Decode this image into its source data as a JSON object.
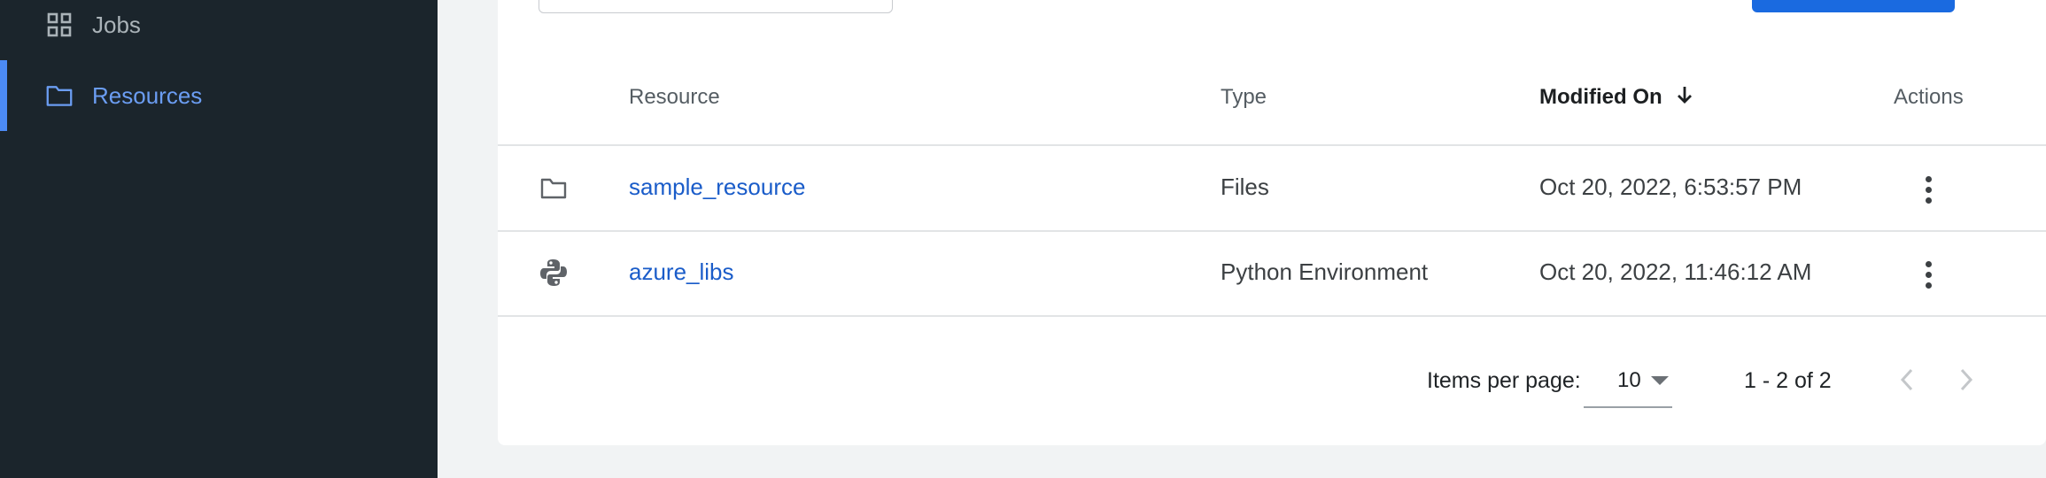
{
  "sidebar": {
    "items": [
      {
        "label": "Jobs",
        "icon": "grid-icon"
      },
      {
        "label": "Resources",
        "icon": "folder-icon",
        "active": true
      }
    ]
  },
  "table": {
    "columns": {
      "resource": "Resource",
      "type": "Type",
      "modified": "Modified On",
      "actions": "Actions"
    },
    "sort": {
      "column": "modified",
      "direction": "descending"
    },
    "rows": [
      {
        "icon": "folder-icon",
        "name": "sample_resource",
        "type": "Files",
        "modified": "Oct 20, 2022, 6:53:57 PM"
      },
      {
        "icon": "python-icon",
        "name": "azure_libs",
        "type": "Python Environment",
        "modified": "Oct 20, 2022, 11:46:12 AM"
      }
    ]
  },
  "paginator": {
    "items_per_page_label": "Items per page:",
    "items_per_page_value": "10",
    "range_label": "1 - 2 of 2"
  },
  "colors": {
    "sidebar_bg": "#1b252c",
    "accent": "#4c8bf5",
    "link": "#1a5cc9",
    "primary_button": "#1a6ae0"
  }
}
